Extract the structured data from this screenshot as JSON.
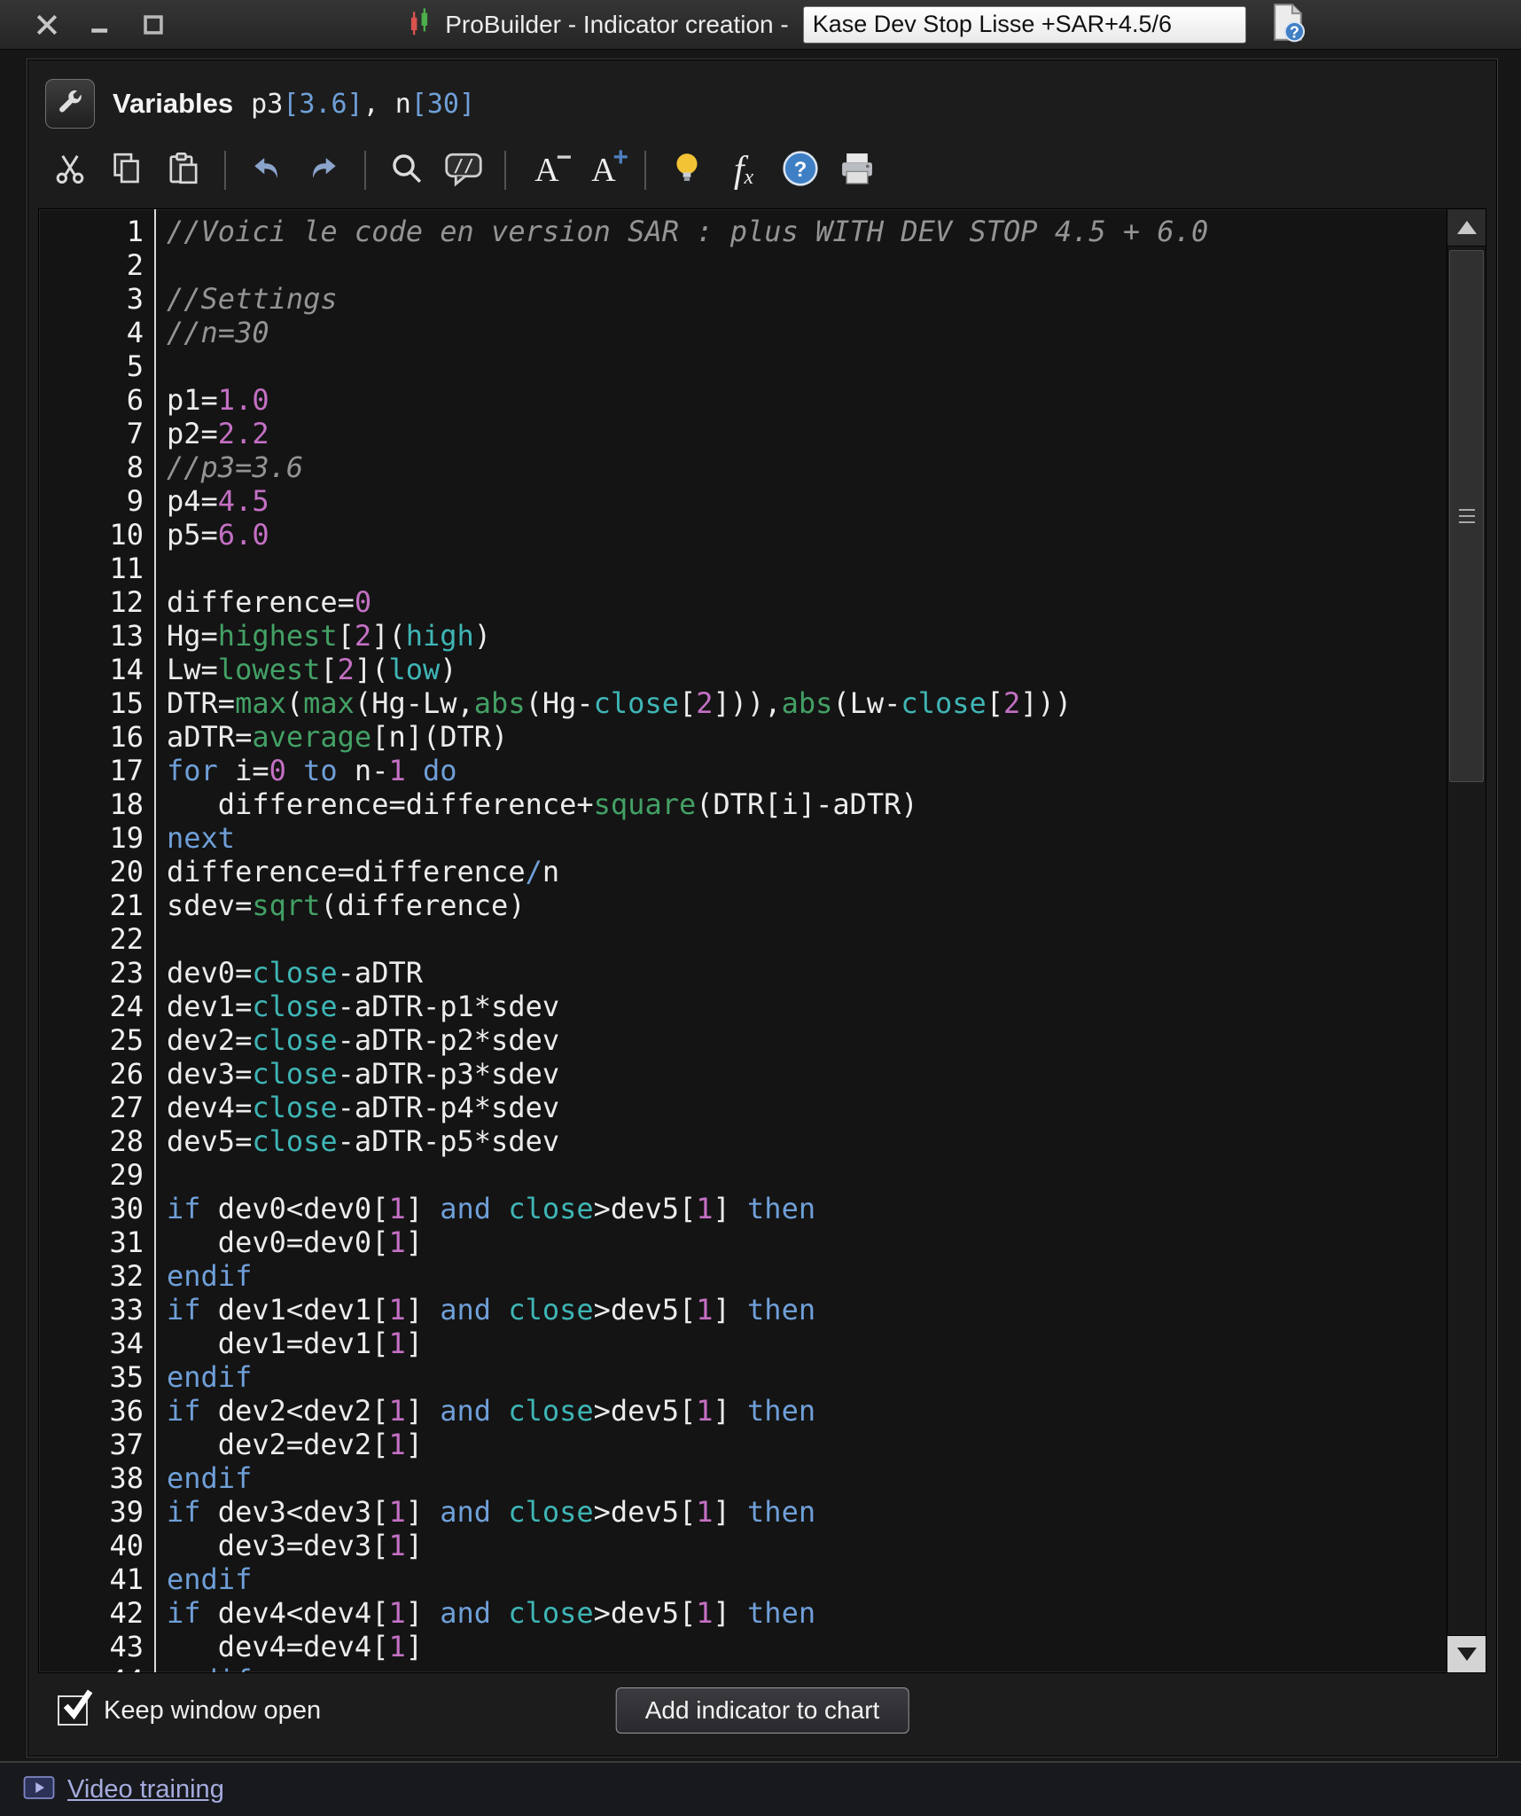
{
  "titlebar": {
    "title": "ProBuilder - Indicator creation -",
    "field_value": "Kase Dev Stop Lisse +SAR+4.5/6"
  },
  "variables_bar": {
    "label": "Variables",
    "value_tokens": [
      [
        "p",
        "p3"
      ],
      [
        "k",
        "[3.6]"
      ],
      [
        "p",
        ", n"
      ],
      [
        "k",
        "[30]"
      ]
    ]
  },
  "toolbar": {
    "icons": [
      "cut",
      "copy",
      "paste",
      "undo",
      "redo",
      "search",
      "comment",
      "font-decrease",
      "font-increase",
      "hint",
      "insert-function",
      "help",
      "print"
    ],
    "glyphs": {
      "comment": "//",
      "font_letter": "A",
      "minus": "−",
      "plus": "+",
      "fx_f": "f",
      "fx_x": "x",
      "help": "?"
    }
  },
  "editor": {
    "lines": [
      [
        [
          "c",
          "//Voici le code en version SAR : plus WITH DEV STOP 4.5 + 6.0"
        ]
      ],
      [],
      [
        [
          "c",
          "//Settings"
        ]
      ],
      [
        [
          "c",
          "//n=30"
        ]
      ],
      [],
      [
        [
          "p",
          "p1="
        ],
        [
          "n",
          "1.0"
        ]
      ],
      [
        [
          "p",
          "p2="
        ],
        [
          "n",
          "2.2"
        ]
      ],
      [
        [
          "c",
          "//p3=3.6"
        ]
      ],
      [
        [
          "p",
          "p4="
        ],
        [
          "n",
          "4.5"
        ]
      ],
      [
        [
          "p",
          "p5="
        ],
        [
          "n",
          "6.0"
        ]
      ],
      [],
      [
        [
          "p",
          "difference="
        ],
        [
          "n",
          "0"
        ]
      ],
      [
        [
          "p",
          "Hg="
        ],
        [
          "f",
          "highest"
        ],
        [
          "p",
          "["
        ],
        [
          "n",
          "2"
        ],
        [
          "p",
          "]("
        ],
        [
          "b",
          "high"
        ],
        [
          "p",
          ")"
        ]
      ],
      [
        [
          "p",
          "Lw="
        ],
        [
          "f",
          "lowest"
        ],
        [
          "p",
          "["
        ],
        [
          "n",
          "2"
        ],
        [
          "p",
          "]("
        ],
        [
          "b",
          "low"
        ],
        [
          "p",
          ")"
        ]
      ],
      [
        [
          "p",
          "DTR="
        ],
        [
          "f",
          "max"
        ],
        [
          "p",
          "("
        ],
        [
          "f",
          "max"
        ],
        [
          "p",
          "(Hg-Lw,"
        ],
        [
          "f",
          "abs"
        ],
        [
          "p",
          "(Hg-"
        ],
        [
          "b",
          "close"
        ],
        [
          "p",
          "["
        ],
        [
          "n",
          "2"
        ],
        [
          "p",
          "])),"
        ],
        [
          "f",
          "abs"
        ],
        [
          "p",
          "(Lw-"
        ],
        [
          "b",
          "close"
        ],
        [
          "p",
          "["
        ],
        [
          "n",
          "2"
        ],
        [
          "p",
          "]))"
        ]
      ],
      [
        [
          "p",
          "aDTR="
        ],
        [
          "f",
          "average"
        ],
        [
          "p",
          "[n](DTR)"
        ]
      ],
      [
        [
          "k",
          "for"
        ],
        [
          "p",
          " i="
        ],
        [
          "n",
          "0"
        ],
        [
          "p",
          " "
        ],
        [
          "k",
          "to"
        ],
        [
          "p",
          " n-"
        ],
        [
          "n",
          "1"
        ],
        [
          "p",
          " "
        ],
        [
          "k",
          "do"
        ]
      ],
      [
        [
          "p",
          "   difference=difference+"
        ],
        [
          "f",
          "square"
        ],
        [
          "p",
          "(DTR[i]-aDTR)"
        ]
      ],
      [
        [
          "k",
          "next"
        ]
      ],
      [
        [
          "p",
          "difference=difference"
        ],
        [
          "k",
          "/"
        ],
        [
          "p",
          "n"
        ]
      ],
      [
        [
          "p",
          "sdev="
        ],
        [
          "f",
          "sqrt"
        ],
        [
          "p",
          "(difference)"
        ]
      ],
      [],
      [
        [
          "p",
          "dev0="
        ],
        [
          "b",
          "close"
        ],
        [
          "p",
          "-aDTR"
        ]
      ],
      [
        [
          "p",
          "dev1="
        ],
        [
          "b",
          "close"
        ],
        [
          "p",
          "-aDTR-p1*sdev"
        ]
      ],
      [
        [
          "p",
          "dev2="
        ],
        [
          "b",
          "close"
        ],
        [
          "p",
          "-aDTR-p2*sdev"
        ]
      ],
      [
        [
          "p",
          "dev3="
        ],
        [
          "b",
          "close"
        ],
        [
          "p",
          "-aDTR-p3*sdev"
        ]
      ],
      [
        [
          "p",
          "dev4="
        ],
        [
          "b",
          "close"
        ],
        [
          "p",
          "-aDTR-p4*sdev"
        ]
      ],
      [
        [
          "p",
          "dev5="
        ],
        [
          "b",
          "close"
        ],
        [
          "p",
          "-aDTR-p5*sdev"
        ]
      ],
      [],
      [
        [
          "k",
          "if"
        ],
        [
          "p",
          " dev0<dev0["
        ],
        [
          "n",
          "1"
        ],
        [
          "p",
          "] "
        ],
        [
          "k",
          "and"
        ],
        [
          "p",
          " "
        ],
        [
          "b",
          "close"
        ],
        [
          "p",
          ">dev5["
        ],
        [
          "n",
          "1"
        ],
        [
          "p",
          "] "
        ],
        [
          "k",
          "then"
        ]
      ],
      [
        [
          "p",
          "   dev0=dev0["
        ],
        [
          "n",
          "1"
        ],
        [
          "p",
          "]"
        ]
      ],
      [
        [
          "k",
          "endif"
        ]
      ],
      [
        [
          "k",
          "if"
        ],
        [
          "p",
          " dev1<dev1["
        ],
        [
          "n",
          "1"
        ],
        [
          "p",
          "] "
        ],
        [
          "k",
          "and"
        ],
        [
          "p",
          " "
        ],
        [
          "b",
          "close"
        ],
        [
          "p",
          ">dev5["
        ],
        [
          "n",
          "1"
        ],
        [
          "p",
          "] "
        ],
        [
          "k",
          "then"
        ]
      ],
      [
        [
          "p",
          "   dev1=dev1["
        ],
        [
          "n",
          "1"
        ],
        [
          "p",
          "]"
        ]
      ],
      [
        [
          "k",
          "endif"
        ]
      ],
      [
        [
          "k",
          "if"
        ],
        [
          "p",
          " dev2<dev2["
        ],
        [
          "n",
          "1"
        ],
        [
          "p",
          "] "
        ],
        [
          "k",
          "and"
        ],
        [
          "p",
          " "
        ],
        [
          "b",
          "close"
        ],
        [
          "p",
          ">dev5["
        ],
        [
          "n",
          "1"
        ],
        [
          "p",
          "] "
        ],
        [
          "k",
          "then"
        ]
      ],
      [
        [
          "p",
          "   dev2=dev2["
        ],
        [
          "n",
          "1"
        ],
        [
          "p",
          "]"
        ]
      ],
      [
        [
          "k",
          "endif"
        ]
      ],
      [
        [
          "k",
          "if"
        ],
        [
          "p",
          " dev3<dev3["
        ],
        [
          "n",
          "1"
        ],
        [
          "p",
          "] "
        ],
        [
          "k",
          "and"
        ],
        [
          "p",
          " "
        ],
        [
          "b",
          "close"
        ],
        [
          "p",
          ">dev5["
        ],
        [
          "n",
          "1"
        ],
        [
          "p",
          "] "
        ],
        [
          "k",
          "then"
        ]
      ],
      [
        [
          "p",
          "   dev3=dev3["
        ],
        [
          "n",
          "1"
        ],
        [
          "p",
          "]"
        ]
      ],
      [
        [
          "k",
          "endif"
        ]
      ],
      [
        [
          "k",
          "if"
        ],
        [
          "p",
          " dev4<dev4["
        ],
        [
          "n",
          "1"
        ],
        [
          "p",
          "] "
        ],
        [
          "k",
          "and"
        ],
        [
          "p",
          " "
        ],
        [
          "b",
          "close"
        ],
        [
          "p",
          ">dev5["
        ],
        [
          "n",
          "1"
        ],
        [
          "p",
          "] "
        ],
        [
          "k",
          "then"
        ]
      ],
      [
        [
          "p",
          "   dev4=dev4["
        ],
        [
          "n",
          "1"
        ],
        [
          "p",
          "]"
        ]
      ],
      [
        [
          "k",
          "endif"
        ]
      ]
    ]
  },
  "bottom": {
    "keep_window_open": "Keep window open",
    "add_button": "Add indicator to chart"
  },
  "footer": {
    "video_training": "Video training"
  },
  "colors": {
    "text": "#ececec",
    "comment": "#949494",
    "keyword": "#6f9fd8",
    "function": "#43a065",
    "builtin": "#3fb5b5",
    "number": "#c470c4",
    "accent_blue": "#3f7fc4",
    "bulb_yellow": "#f2c335"
  }
}
